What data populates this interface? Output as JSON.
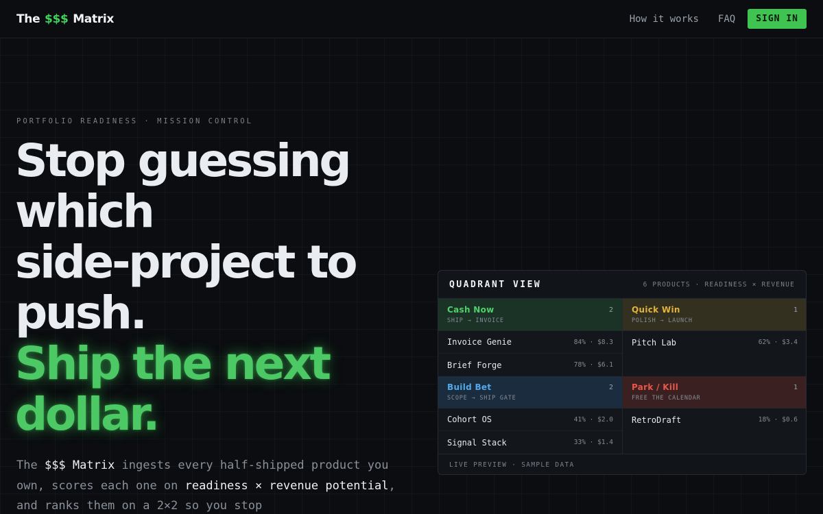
{
  "nav": {
    "brand_prefix": "The",
    "brand_money": "$$$",
    "brand_suffix": "Matrix",
    "links": [
      "How it works",
      "FAQ"
    ],
    "signin_label": "SIGN IN"
  },
  "hero": {
    "eyebrow": "PORTFOLIO READINESS · MISSION CONTROL",
    "headline_lines": [
      "Stop guessing",
      "which",
      "side-project to",
      "push."
    ],
    "headline_green_lines": [
      "Ship the next",
      "dollar."
    ],
    "body": {
      "p1": "The ",
      "hl1": "$$$ Matrix",
      "p2": " ingests every half-shipped product you own, scores each one on ",
      "hl2": "readiness × revenue potential",
      "p3": ", and ranks them on a 2×2 so you stop"
    }
  },
  "card": {
    "title": "QUADRANT VIEW",
    "meta": "6 PRODUCTS · READINESS × REVENUE",
    "footer": "LIVE PREVIEW · SAMPLE DATA",
    "quadrants": [
      {
        "name": "Cash Now",
        "sub": "SHIP → INVOICE",
        "count": "2",
        "accent": "#4fd06a",
        "items": [
          {
            "name": "Invoice Genie",
            "stat": "84% · $8.3"
          },
          {
            "name": "Brief Forge",
            "stat": "78% · $6.1"
          }
        ]
      },
      {
        "name": "Quick Win",
        "sub": "POLISH → LAUNCH",
        "count": "1",
        "accent": "#e2b33e",
        "items": [
          {
            "name": "Pitch Lab",
            "stat": "62% · $3.4"
          }
        ]
      },
      {
        "name": "Build Bet",
        "sub": "SCOPE → SHIP GATE",
        "count": "2",
        "accent": "#52a8e8",
        "items": [
          {
            "name": "Cohort OS",
            "stat": "41% · $2.0"
          },
          {
            "name": "Signal Stack",
            "stat": "33% · $1.4"
          }
        ]
      },
      {
        "name": "Park / Kill",
        "sub": "FREE THE CALENDAR",
        "count": "1",
        "accent": "#e8574b",
        "items": [
          {
            "name": "RetroDraft",
            "stat": "18% · $0.6"
          }
        ]
      }
    ]
  }
}
